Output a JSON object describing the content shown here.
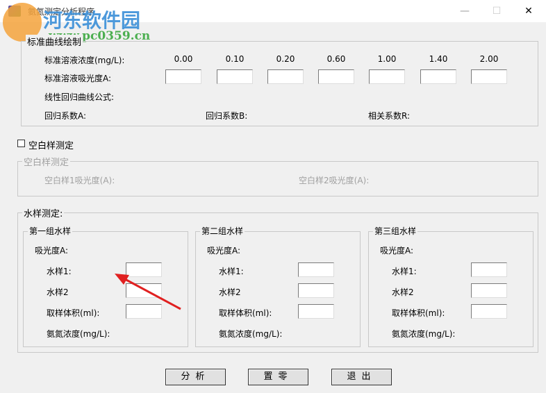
{
  "window": {
    "title": "氨氮测定分析程序",
    "minimize": "—",
    "maximize": "☐",
    "close": "✕"
  },
  "watermark": {
    "name": "河东软件园",
    "url": "www.pc0359.cn"
  },
  "standard": {
    "title": "标准曲线绘制",
    "conc_label": "标准溶液浓度(mg/L):",
    "concs": [
      "0.00",
      "0.10",
      "0.20",
      "0.60",
      "1.00",
      "1.40",
      "2.00"
    ],
    "abs_label": "标准溶液吸光度A:",
    "formula_label": "线性回归曲线公式:",
    "coefA": "回归系数A:",
    "coefB": "回归系数B:",
    "coefR": "相关系数R:"
  },
  "blank": {
    "checkbox_label": "空白样测定",
    "checked": false,
    "group_title": "空白样测定",
    "blank1": "空白样1吸光度(A):",
    "blank2": "空白样2吸光度(A):"
  },
  "water": {
    "title": "水样测定:",
    "groups": [
      {
        "title": "第一组水样",
        "abs": "吸光度A:",
        "s1": "水样1:",
        "s2": "水样2",
        "vol": "取样体积(ml):",
        "conc": "氨氮浓度(mg/L):"
      },
      {
        "title": "第二组水样",
        "abs": "吸光度A:",
        "s1": "水样1:",
        "s2": "水样2",
        "vol": "取样体积(ml):",
        "conc": "氨氮浓度(mg/L):"
      },
      {
        "title": "第三组水样",
        "abs": "吸光度A:",
        "s1": "水样1:",
        "s2": "水样2",
        "vol": "取样体积(ml):",
        "conc": "氨氮浓度(mg/L):"
      }
    ]
  },
  "buttons": {
    "analyze": "分析",
    "reset": "置零",
    "exit": "退出"
  }
}
